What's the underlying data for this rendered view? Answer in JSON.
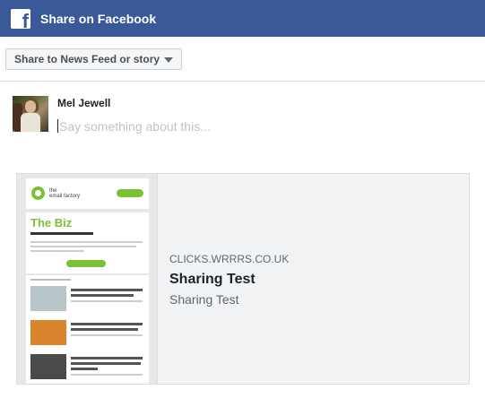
{
  "header": {
    "title": "Share on Facebook",
    "logo_icon": "facebook-logo",
    "color": "#3b5998"
  },
  "destination": {
    "label": "Share to News Feed or story",
    "icon": "caret-down"
  },
  "composer": {
    "user_name": "Mel Jewell",
    "placeholder": "Say something about this..."
  },
  "link_preview": {
    "domain": "CLICKS.WRRRS.CO.UK",
    "title": "Sharing Test",
    "description": "Sharing Test"
  }
}
